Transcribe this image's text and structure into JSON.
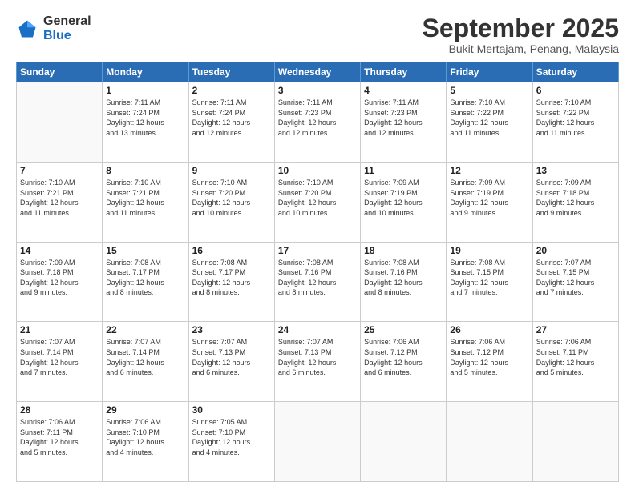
{
  "header": {
    "logo_general": "General",
    "logo_blue": "Blue",
    "month_title": "September 2025",
    "subtitle": "Bukit Mertajam, Penang, Malaysia"
  },
  "weekdays": [
    "Sunday",
    "Monday",
    "Tuesday",
    "Wednesday",
    "Thursday",
    "Friday",
    "Saturday"
  ],
  "weeks": [
    [
      {
        "day": "",
        "info": ""
      },
      {
        "day": "1",
        "info": "Sunrise: 7:11 AM\nSunset: 7:24 PM\nDaylight: 12 hours\nand 13 minutes."
      },
      {
        "day": "2",
        "info": "Sunrise: 7:11 AM\nSunset: 7:24 PM\nDaylight: 12 hours\nand 12 minutes."
      },
      {
        "day": "3",
        "info": "Sunrise: 7:11 AM\nSunset: 7:23 PM\nDaylight: 12 hours\nand 12 minutes."
      },
      {
        "day": "4",
        "info": "Sunrise: 7:11 AM\nSunset: 7:23 PM\nDaylight: 12 hours\nand 12 minutes."
      },
      {
        "day": "5",
        "info": "Sunrise: 7:10 AM\nSunset: 7:22 PM\nDaylight: 12 hours\nand 11 minutes."
      },
      {
        "day": "6",
        "info": "Sunrise: 7:10 AM\nSunset: 7:22 PM\nDaylight: 12 hours\nand 11 minutes."
      }
    ],
    [
      {
        "day": "7",
        "info": "Sunrise: 7:10 AM\nSunset: 7:21 PM\nDaylight: 12 hours\nand 11 minutes."
      },
      {
        "day": "8",
        "info": "Sunrise: 7:10 AM\nSunset: 7:21 PM\nDaylight: 12 hours\nand 11 minutes."
      },
      {
        "day": "9",
        "info": "Sunrise: 7:10 AM\nSunset: 7:20 PM\nDaylight: 12 hours\nand 10 minutes."
      },
      {
        "day": "10",
        "info": "Sunrise: 7:10 AM\nSunset: 7:20 PM\nDaylight: 12 hours\nand 10 minutes."
      },
      {
        "day": "11",
        "info": "Sunrise: 7:09 AM\nSunset: 7:19 PM\nDaylight: 12 hours\nand 10 minutes."
      },
      {
        "day": "12",
        "info": "Sunrise: 7:09 AM\nSunset: 7:19 PM\nDaylight: 12 hours\nand 9 minutes."
      },
      {
        "day": "13",
        "info": "Sunrise: 7:09 AM\nSunset: 7:18 PM\nDaylight: 12 hours\nand 9 minutes."
      }
    ],
    [
      {
        "day": "14",
        "info": "Sunrise: 7:09 AM\nSunset: 7:18 PM\nDaylight: 12 hours\nand 9 minutes."
      },
      {
        "day": "15",
        "info": "Sunrise: 7:08 AM\nSunset: 7:17 PM\nDaylight: 12 hours\nand 8 minutes."
      },
      {
        "day": "16",
        "info": "Sunrise: 7:08 AM\nSunset: 7:17 PM\nDaylight: 12 hours\nand 8 minutes."
      },
      {
        "day": "17",
        "info": "Sunrise: 7:08 AM\nSunset: 7:16 PM\nDaylight: 12 hours\nand 8 minutes."
      },
      {
        "day": "18",
        "info": "Sunrise: 7:08 AM\nSunset: 7:16 PM\nDaylight: 12 hours\nand 8 minutes."
      },
      {
        "day": "19",
        "info": "Sunrise: 7:08 AM\nSunset: 7:15 PM\nDaylight: 12 hours\nand 7 minutes."
      },
      {
        "day": "20",
        "info": "Sunrise: 7:07 AM\nSunset: 7:15 PM\nDaylight: 12 hours\nand 7 minutes."
      }
    ],
    [
      {
        "day": "21",
        "info": "Sunrise: 7:07 AM\nSunset: 7:14 PM\nDaylight: 12 hours\nand 7 minutes."
      },
      {
        "day": "22",
        "info": "Sunrise: 7:07 AM\nSunset: 7:14 PM\nDaylight: 12 hours\nand 6 minutes."
      },
      {
        "day": "23",
        "info": "Sunrise: 7:07 AM\nSunset: 7:13 PM\nDaylight: 12 hours\nand 6 minutes."
      },
      {
        "day": "24",
        "info": "Sunrise: 7:07 AM\nSunset: 7:13 PM\nDaylight: 12 hours\nand 6 minutes."
      },
      {
        "day": "25",
        "info": "Sunrise: 7:06 AM\nSunset: 7:12 PM\nDaylight: 12 hours\nand 6 minutes."
      },
      {
        "day": "26",
        "info": "Sunrise: 7:06 AM\nSunset: 7:12 PM\nDaylight: 12 hours\nand 5 minutes."
      },
      {
        "day": "27",
        "info": "Sunrise: 7:06 AM\nSunset: 7:11 PM\nDaylight: 12 hours\nand 5 minutes."
      }
    ],
    [
      {
        "day": "28",
        "info": "Sunrise: 7:06 AM\nSunset: 7:11 PM\nDaylight: 12 hours\nand 5 minutes."
      },
      {
        "day": "29",
        "info": "Sunrise: 7:06 AM\nSunset: 7:10 PM\nDaylight: 12 hours\nand 4 minutes."
      },
      {
        "day": "30",
        "info": "Sunrise: 7:05 AM\nSunset: 7:10 PM\nDaylight: 12 hours\nand 4 minutes."
      },
      {
        "day": "",
        "info": ""
      },
      {
        "day": "",
        "info": ""
      },
      {
        "day": "",
        "info": ""
      },
      {
        "day": "",
        "info": ""
      }
    ]
  ]
}
